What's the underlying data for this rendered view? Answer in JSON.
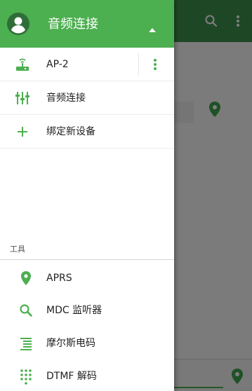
{
  "colors": {
    "accent": "#4caf50",
    "accent_dark": "#3d8f4a",
    "text_primary": "#212121",
    "text_secondary": "#555555"
  },
  "header": {
    "title": "音频连接",
    "avatar_icon": "account-circle-icon",
    "toggle_icon": "caret-up-icon"
  },
  "devices": [
    {
      "label": "AP-2",
      "icon": "router-icon",
      "menu_icon": "more-vert-icon"
    },
    {
      "label": "音频连接",
      "icon": "equalizer-icon"
    },
    {
      "label": "绑定新设备",
      "icon": "plus-icon"
    }
  ],
  "tools": {
    "section_label": "工具",
    "items": [
      {
        "label": "APRS",
        "icon": "map-pin-icon"
      },
      {
        "label": "MDC 监听器",
        "icon": "search-icon"
      },
      {
        "label": "摩尔斯电码",
        "icon": "list-icon"
      },
      {
        "label": "DTMF 解码",
        "icon": "dialpad-icon"
      }
    ]
  },
  "background_app": {
    "toolbar_icons": [
      "search-icon",
      "more-vert-icon"
    ],
    "map_markers": [
      "map-pin-icon",
      "map-pin-icon"
    ]
  }
}
